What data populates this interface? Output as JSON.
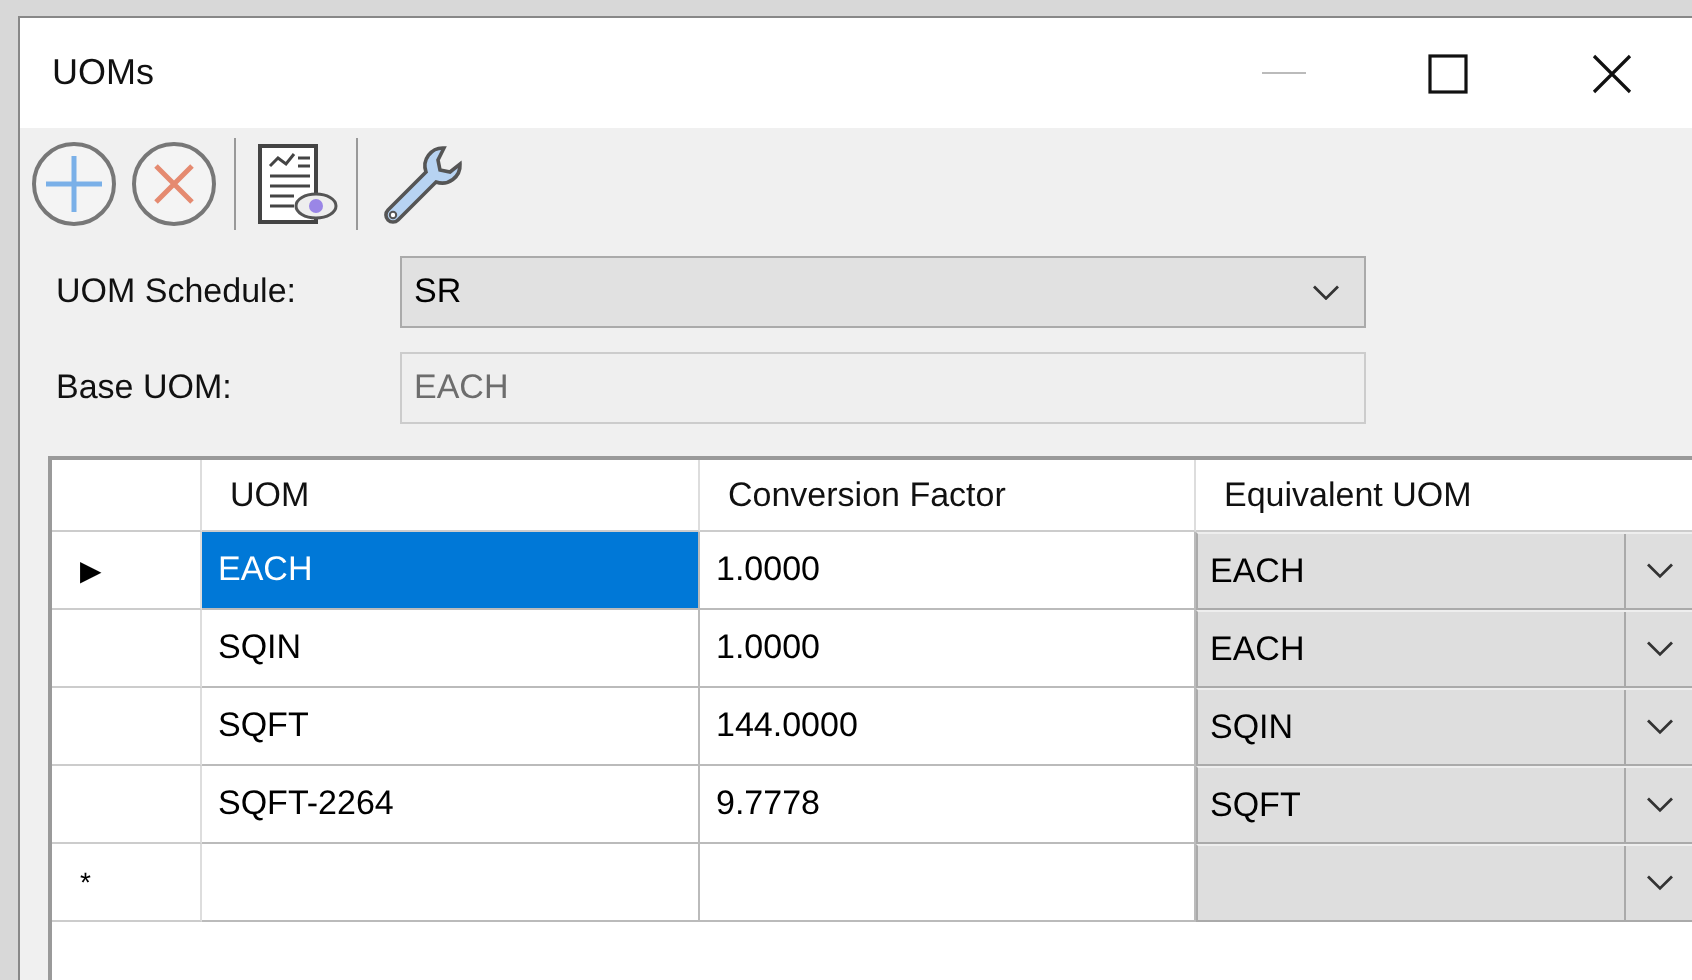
{
  "window": {
    "title": "UOMs"
  },
  "toolbar": {
    "items": [
      {
        "kind": "add"
      },
      {
        "kind": "remove"
      },
      {
        "kind": "separator"
      },
      {
        "kind": "preview"
      },
      {
        "kind": "separator"
      },
      {
        "kind": "settings"
      }
    ]
  },
  "form": {
    "schedule": {
      "label": "UOM Schedule:",
      "value": "SR"
    },
    "base": {
      "label": "Base UOM:",
      "value": "EACH",
      "disabled": true
    }
  },
  "table": {
    "columns": [
      "UOM",
      "Conversion Factor",
      "Equivalent UOM"
    ],
    "rows": [
      {
        "marker": "▶",
        "uom": "EACH",
        "factor": "1.0000",
        "equivalent": "EACH",
        "selected": true
      },
      {
        "uom": "SQIN",
        "factor": "1.0000",
        "equivalent": "EACH",
        "selected": false
      },
      {
        "uom": "SQFT",
        "factor": "144.0000",
        "equivalent": "SQIN",
        "selected": false
      },
      {
        "uom": "SQFT-2264",
        "factor": "9.7778",
        "equivalent": "SQFT",
        "selected": false
      },
      {
        "marker": "*",
        "uom": "",
        "factor": "",
        "equivalent": "",
        "selected": false
      }
    ]
  }
}
